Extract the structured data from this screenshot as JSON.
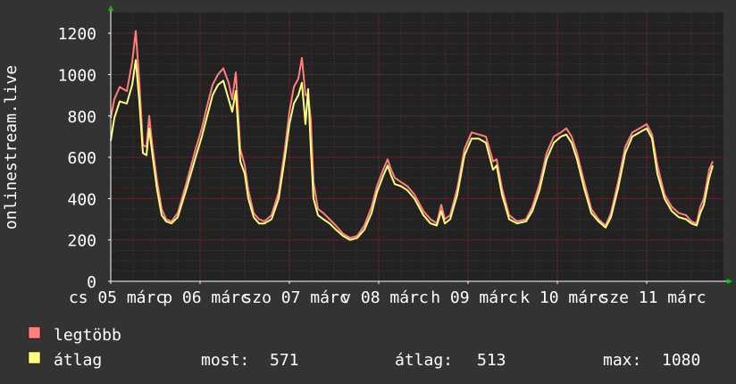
{
  "chart_data": {
    "type": "line",
    "ylabel": "onlinestream.live",
    "ylim": [
      0,
      1300
    ],
    "yticks": [
      0,
      200,
      400,
      600,
      800,
      1000,
      1200
    ],
    "grid": true,
    "x_tick_labels": [
      "cs 05 márc",
      "p 06 márc",
      "szo 07 márc",
      "v 08 márc",
      "h 09 márc",
      "k 10 márc",
      "sze 11 márc"
    ],
    "x_range_days": [
      0,
      6.86
    ],
    "colors": {
      "background": "#333333",
      "plot_area": "#222222",
      "grid": "#6b3a3a",
      "axis": "#ffffff",
      "text": "#ffffff",
      "arrow": "#00cc00",
      "max_series": "#ff7f7f",
      "avg_series": "#ffff7f"
    },
    "series": [
      {
        "name": "legtöbb",
        "key": "max",
        "points": [
          [
            0.0,
            790
          ],
          [
            0.04,
            880
          ],
          [
            0.1,
            940
          ],
          [
            0.18,
            920
          ],
          [
            0.24,
            1060
          ],
          [
            0.28,
            1210
          ],
          [
            0.32,
            960
          ],
          [
            0.36,
            660
          ],
          [
            0.4,
            650
          ],
          [
            0.43,
            800
          ],
          [
            0.47,
            640
          ],
          [
            0.52,
            480
          ],
          [
            0.57,
            350
          ],
          [
            0.62,
            300
          ],
          [
            0.68,
            290
          ],
          [
            0.75,
            330
          ],
          [
            0.85,
            480
          ],
          [
            0.95,
            640
          ],
          [
            1.02,
            740
          ],
          [
            1.08,
            850
          ],
          [
            1.14,
            950
          ],
          [
            1.2,
            1000
          ],
          [
            1.26,
            1030
          ],
          [
            1.32,
            960
          ],
          [
            1.36,
            880
          ],
          [
            1.4,
            1010
          ],
          [
            1.45,
            640
          ],
          [
            1.5,
            560
          ],
          [
            1.54,
            440
          ],
          [
            1.6,
            330
          ],
          [
            1.66,
            300
          ],
          [
            1.72,
            290
          ],
          [
            1.8,
            320
          ],
          [
            1.88,
            430
          ],
          [
            1.95,
            640
          ],
          [
            2.0,
            820
          ],
          [
            2.05,
            940
          ],
          [
            2.1,
            980
          ],
          [
            2.14,
            1080
          ],
          [
            2.18,
            900
          ],
          [
            2.21,
            900
          ],
          [
            2.24,
            780
          ],
          [
            2.27,
            480
          ],
          [
            2.32,
            350
          ],
          [
            2.38,
            330
          ],
          [
            2.45,
            300
          ],
          [
            2.52,
            270
          ],
          [
            2.6,
            230
          ],
          [
            2.68,
            210
          ],
          [
            2.76,
            220
          ],
          [
            2.84,
            270
          ],
          [
            2.92,
            360
          ],
          [
            2.98,
            460
          ],
          [
            3.05,
            540
          ],
          [
            3.1,
            590
          ],
          [
            3.14,
            540
          ],
          [
            3.18,
            500
          ],
          [
            3.25,
            480
          ],
          [
            3.32,
            460
          ],
          [
            3.4,
            420
          ],
          [
            3.5,
            340
          ],
          [
            3.58,
            300
          ],
          [
            3.65,
            280
          ],
          [
            3.7,
            370
          ],
          [
            3.74,
            300
          ],
          [
            3.8,
            320
          ],
          [
            3.88,
            450
          ],
          [
            3.96,
            640
          ],
          [
            4.04,
            720
          ],
          [
            4.12,
            710
          ],
          [
            4.2,
            700
          ],
          [
            4.28,
            580
          ],
          [
            4.32,
            590
          ],
          [
            4.38,
            450
          ],
          [
            4.46,
            320
          ],
          [
            4.55,
            290
          ],
          [
            4.65,
            300
          ],
          [
            4.72,
            360
          ],
          [
            4.8,
            470
          ],
          [
            4.88,
            620
          ],
          [
            4.96,
            700
          ],
          [
            5.04,
            720
          ],
          [
            5.1,
            740
          ],
          [
            5.16,
            700
          ],
          [
            5.22,
            620
          ],
          [
            5.3,
            480
          ],
          [
            5.38,
            350
          ],
          [
            5.46,
            300
          ],
          [
            5.54,
            270
          ],
          [
            5.6,
            330
          ],
          [
            5.68,
            480
          ],
          [
            5.76,
            650
          ],
          [
            5.84,
            720
          ],
          [
            5.92,
            740
          ],
          [
            6.0,
            760
          ],
          [
            6.06,
            710
          ],
          [
            6.12,
            560
          ],
          [
            6.2,
            420
          ],
          [
            6.28,
            360
          ],
          [
            6.36,
            330
          ],
          [
            6.44,
            320
          ],
          [
            6.5,
            290
          ],
          [
            6.56,
            280
          ],
          [
            6.6,
            360
          ],
          [
            6.64,
            400
          ],
          [
            6.7,
            540
          ],
          [
            6.74,
            580
          ]
        ]
      },
      {
        "name": "átlag",
        "key": "avg",
        "points": [
          [
            0.0,
            680
          ],
          [
            0.04,
            790
          ],
          [
            0.1,
            870
          ],
          [
            0.18,
            860
          ],
          [
            0.24,
            950
          ],
          [
            0.28,
            1070
          ],
          [
            0.32,
            870
          ],
          [
            0.36,
            620
          ],
          [
            0.4,
            610
          ],
          [
            0.43,
            740
          ],
          [
            0.47,
            600
          ],
          [
            0.52,
            440
          ],
          [
            0.57,
            320
          ],
          [
            0.62,
            290
          ],
          [
            0.68,
            280
          ],
          [
            0.75,
            310
          ],
          [
            0.85,
            450
          ],
          [
            0.95,
            600
          ],
          [
            1.02,
            700
          ],
          [
            1.08,
            800
          ],
          [
            1.14,
            900
          ],
          [
            1.2,
            950
          ],
          [
            1.26,
            970
          ],
          [
            1.32,
            880
          ],
          [
            1.36,
            820
          ],
          [
            1.4,
            920
          ],
          [
            1.45,
            580
          ],
          [
            1.5,
            520
          ],
          [
            1.54,
            400
          ],
          [
            1.6,
            310
          ],
          [
            1.66,
            280
          ],
          [
            1.72,
            280
          ],
          [
            1.8,
            300
          ],
          [
            1.88,
            400
          ],
          [
            1.95,
            600
          ],
          [
            2.0,
            760
          ],
          [
            2.05,
            860
          ],
          [
            2.1,
            900
          ],
          [
            2.14,
            960
          ],
          [
            2.18,
            760
          ],
          [
            2.21,
            930
          ],
          [
            2.24,
            640
          ],
          [
            2.27,
            400
          ],
          [
            2.32,
            320
          ],
          [
            2.38,
            300
          ],
          [
            2.45,
            280
          ],
          [
            2.52,
            250
          ],
          [
            2.6,
            220
          ],
          [
            2.68,
            200
          ],
          [
            2.76,
            210
          ],
          [
            2.84,
            250
          ],
          [
            2.92,
            330
          ],
          [
            2.98,
            430
          ],
          [
            3.05,
            510
          ],
          [
            3.1,
            560
          ],
          [
            3.14,
            510
          ],
          [
            3.18,
            470
          ],
          [
            3.25,
            460
          ],
          [
            3.32,
            440
          ],
          [
            3.4,
            400
          ],
          [
            3.5,
            320
          ],
          [
            3.58,
            280
          ],
          [
            3.65,
            270
          ],
          [
            3.7,
            340
          ],
          [
            3.74,
            280
          ],
          [
            3.8,
            300
          ],
          [
            3.88,
            420
          ],
          [
            3.96,
            610
          ],
          [
            4.04,
            690
          ],
          [
            4.12,
            690
          ],
          [
            4.2,
            670
          ],
          [
            4.28,
            540
          ],
          [
            4.32,
            560
          ],
          [
            4.38,
            420
          ],
          [
            4.46,
            300
          ],
          [
            4.55,
            280
          ],
          [
            4.65,
            290
          ],
          [
            4.72,
            340
          ],
          [
            4.8,
            440
          ],
          [
            4.88,
            590
          ],
          [
            4.96,
            670
          ],
          [
            5.04,
            700
          ],
          [
            5.1,
            710
          ],
          [
            5.16,
            670
          ],
          [
            5.22,
            590
          ],
          [
            5.3,
            450
          ],
          [
            5.38,
            330
          ],
          [
            5.46,
            290
          ],
          [
            5.54,
            260
          ],
          [
            5.6,
            310
          ],
          [
            5.68,
            450
          ],
          [
            5.76,
            620
          ],
          [
            5.84,
            700
          ],
          [
            5.92,
            720
          ],
          [
            6.0,
            740
          ],
          [
            6.06,
            690
          ],
          [
            6.12,
            520
          ],
          [
            6.2,
            400
          ],
          [
            6.28,
            340
          ],
          [
            6.36,
            310
          ],
          [
            6.44,
            300
          ],
          [
            6.5,
            280
          ],
          [
            6.56,
            270
          ],
          [
            6.6,
            330
          ],
          [
            6.64,
            370
          ],
          [
            6.7,
            500
          ],
          [
            6.74,
            560
          ]
        ]
      }
    ],
    "legend": [
      {
        "label": "legtöbb",
        "color": "#ff7f7f"
      },
      {
        "label": "átlag",
        "color": "#ffff7f"
      }
    ],
    "stats": {
      "current_label": "most:",
      "current_value": "571",
      "avg_label": "átlag:",
      "avg_value": "513",
      "max_label": "max:",
      "max_value": "1080"
    }
  }
}
